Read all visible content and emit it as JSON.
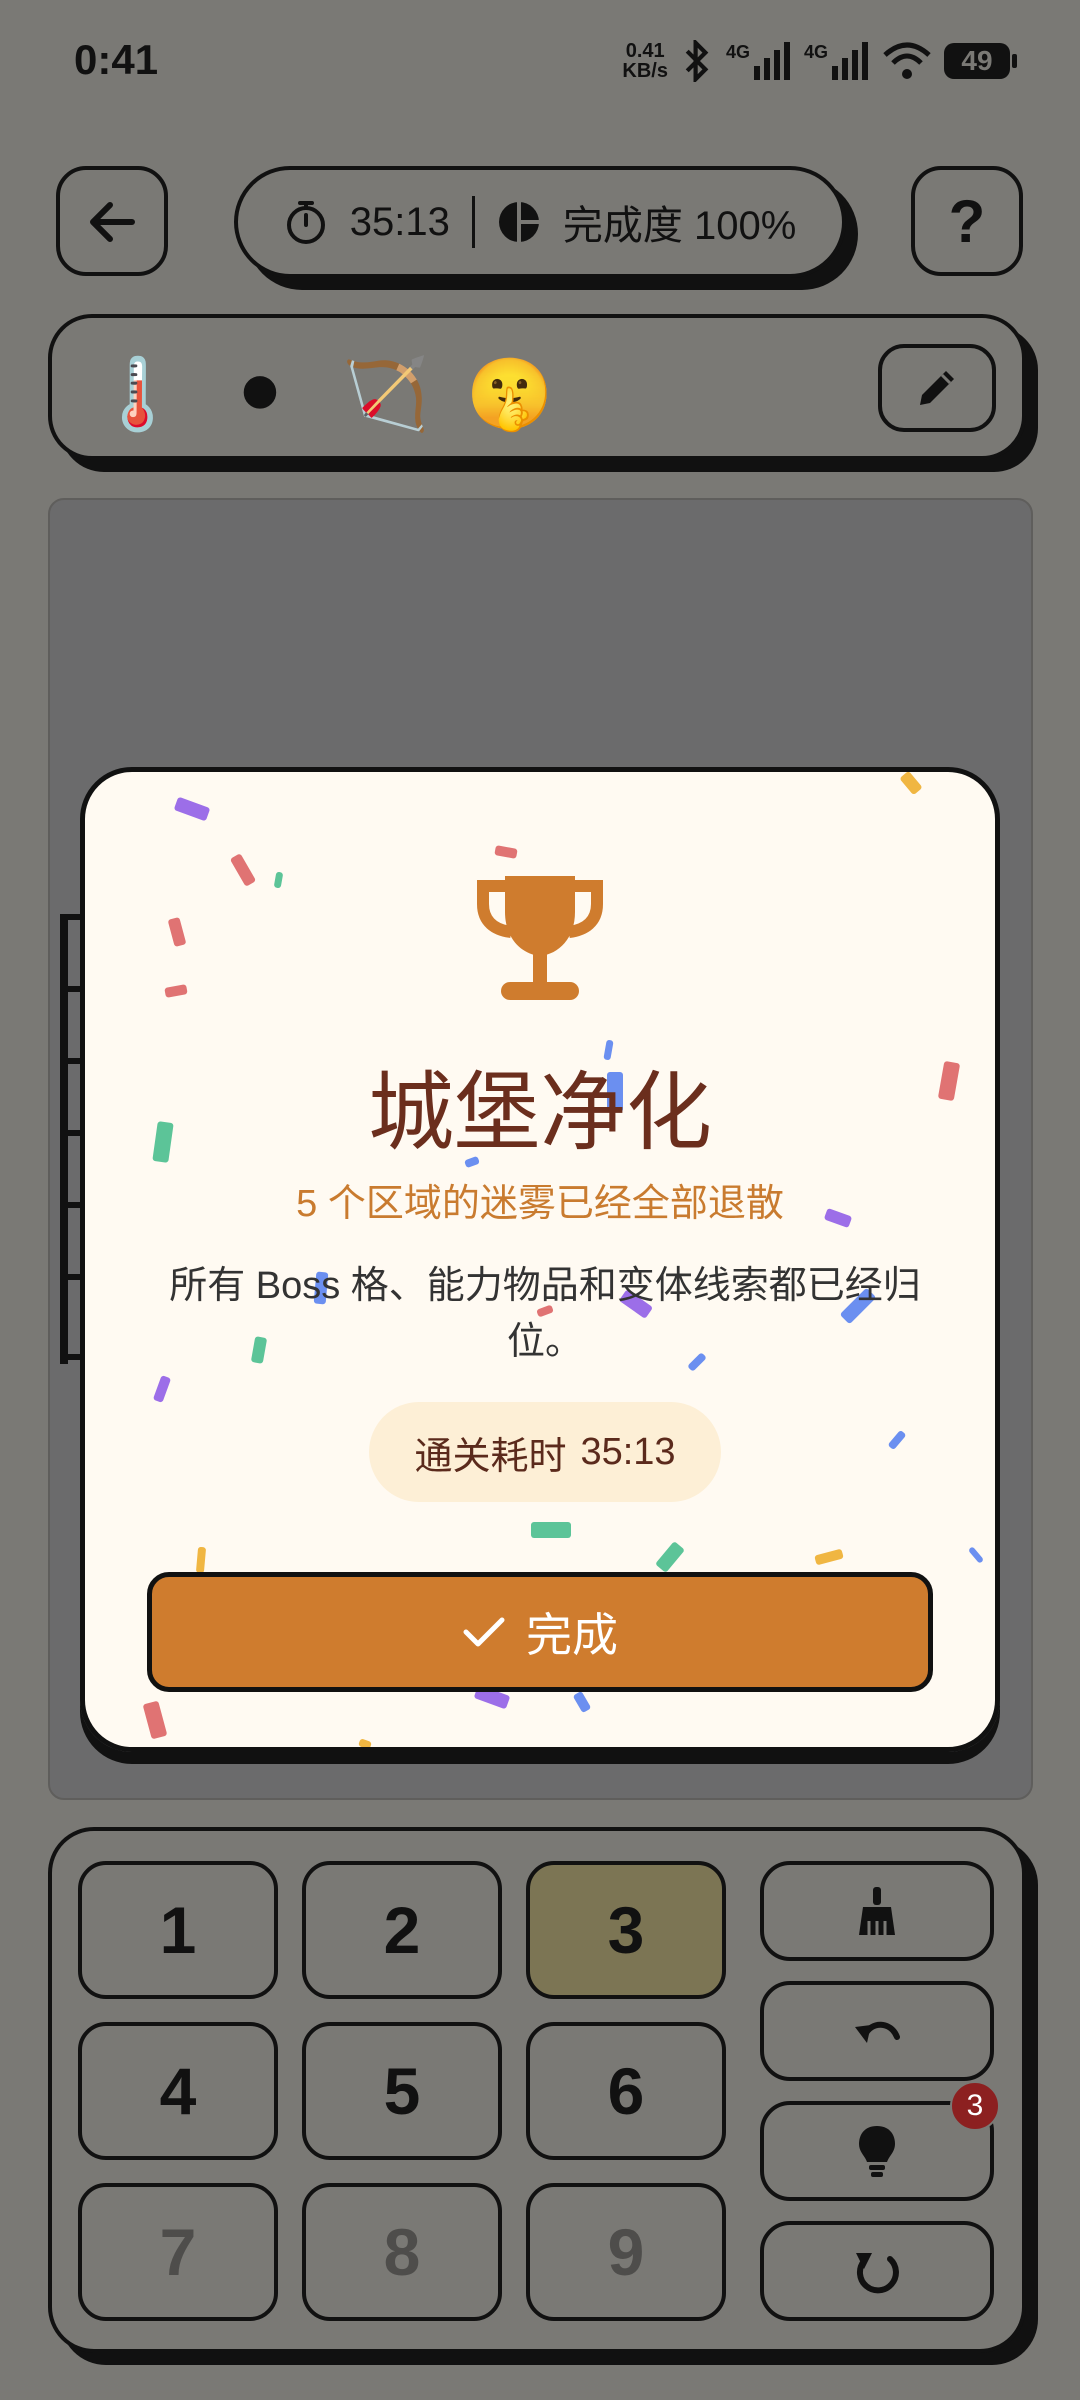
{
  "status_bar": {
    "time": "0:41",
    "net_speed": "0.41",
    "net_unit": "KB/s",
    "sim1": "4G",
    "sim2": "4G",
    "battery": "49"
  },
  "header": {
    "timer": "35:13",
    "progress_label": "完成度 100%",
    "help_label": "?"
  },
  "toolbar": {
    "items": [
      "🌡️",
      "⚫",
      "🏹",
      "🤫"
    ]
  },
  "modal": {
    "title": "城堡净化",
    "subtitle": "5 个区域的迷雾已经全部退散",
    "description": "所有 Boss 格、能力物品和变体线索都已经归位。",
    "time_label": "通关耗时",
    "time_value": "35:13",
    "done_label": "完成",
    "colors": {
      "accent": "#cf7c2e",
      "title": "#6b2e1d",
      "card": "#fffaf2"
    }
  },
  "keypad": {
    "keys": [
      "1",
      "2",
      "3",
      "4",
      "5",
      "6",
      "7",
      "8",
      "9"
    ],
    "selected": "3",
    "hint_count": "3"
  }
}
